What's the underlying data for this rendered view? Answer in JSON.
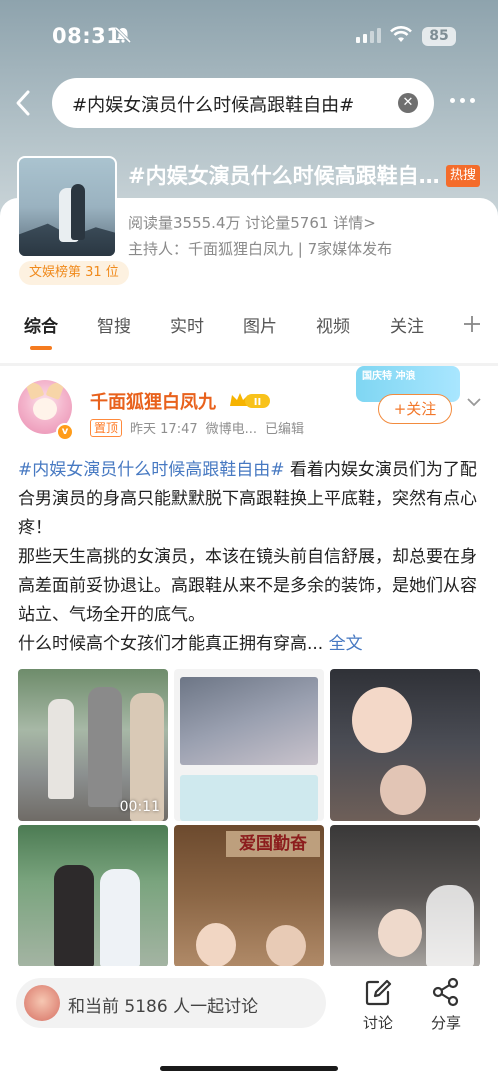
{
  "status_bar": {
    "time": "08:31",
    "battery": "85"
  },
  "search": {
    "query": "#内娱女演员什么时候高跟鞋自由#",
    "clear_icon": "clear-icon"
  },
  "topic": {
    "title": "#内娱女演员什么时候高跟鞋自由#",
    "hot_badge": "热搜",
    "stats": "阅读量3555.4万  讨论量5761  详情>",
    "host": "主持人：千面狐狸白凤九 | 7家媒体发布",
    "rank": "文娱榜第 31 位"
  },
  "tabs": [
    {
      "label": "综合",
      "active": true
    },
    {
      "label": "智搜"
    },
    {
      "label": "实时"
    },
    {
      "label": "图片"
    },
    {
      "label": "视频"
    },
    {
      "label": "关注"
    }
  ],
  "post": {
    "author": "千面狐狸白凤九",
    "level_badge": "II",
    "pinned": "置顶",
    "time": "昨天 17:47",
    "source": "微博电...",
    "edited": "已编辑",
    "follow_label": "+关注",
    "promo_text": "国庆特 冲浪",
    "hashtag": "#内娱女演员什么时候高跟鞋自由#",
    "body": " 看着内娱女演员们为了配合男演员的身高只能默默脱下高跟鞋换上平底鞋，突然有点心疼！\n那些天生高挑的女演员，本该在镜头前自信舒展，却总要在身高差面前妥协退让。高跟鞋从来不是多余的装饰，是她们从容站立、气场全开的底气。\n什么时候高个女孩们才能真正拥有穿高...",
    "full_link": "全文",
    "video_duration": "00:11",
    "image5_sign": "爱国勤奋"
  },
  "bottom": {
    "discuss_text": "和当前 5186 人一起讨论",
    "comment_label": "讨论",
    "share_label": "分享"
  },
  "colors": {
    "accent": "#f57b1f",
    "link": "#4779c2",
    "author": "#e8611c"
  }
}
